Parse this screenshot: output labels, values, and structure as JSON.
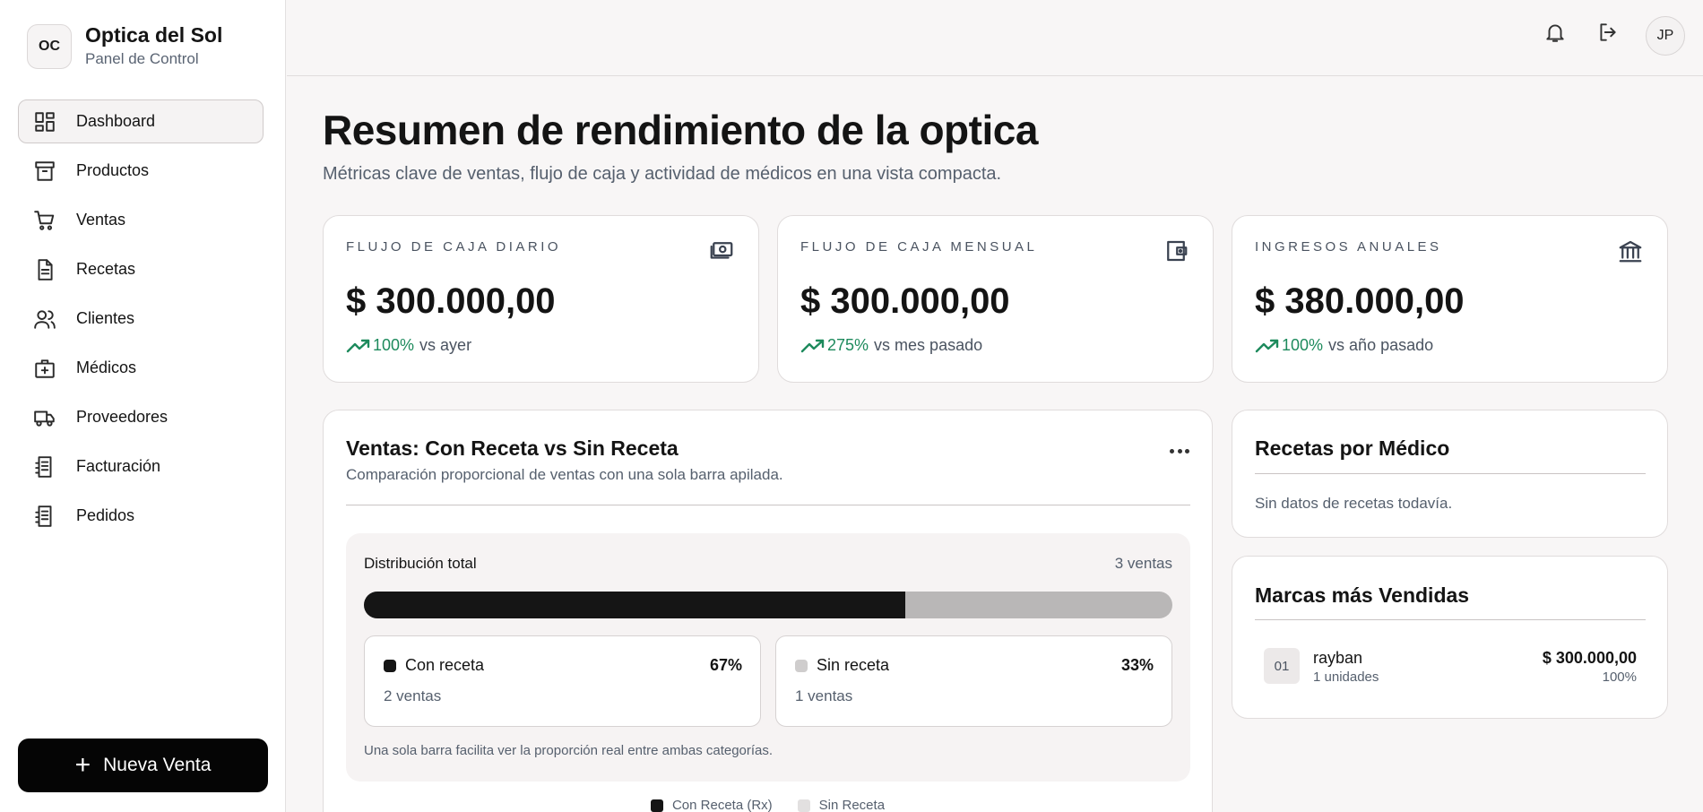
{
  "brand": {
    "logo": "OC",
    "name": "Optica del Sol",
    "subtitle": "Panel de Control"
  },
  "nav": [
    {
      "label": "Dashboard",
      "icon": "dashboard-icon",
      "active": true
    },
    {
      "label": "Productos",
      "icon": "archive-icon"
    },
    {
      "label": "Ventas",
      "icon": "cart-icon"
    },
    {
      "label": "Recetas",
      "icon": "document-icon"
    },
    {
      "label": "Clientes",
      "icon": "users-icon"
    },
    {
      "label": "Médicos",
      "icon": "medical-kit-icon"
    },
    {
      "label": "Proveedores",
      "icon": "truck-icon"
    },
    {
      "label": "Facturación",
      "icon": "receipt-icon"
    },
    {
      "label": "Pedidos",
      "icon": "receipt-icon"
    }
  ],
  "new_sale": {
    "label": "Nueva Venta"
  },
  "topbar": {
    "avatar": "JP"
  },
  "header": {
    "title": "Resumen de rendimiento de la optica",
    "subtitle": "Métricas clave de ventas, flujo de caja y actividad de médicos en una vista compacta."
  },
  "kpis": [
    {
      "label": "Flujo de caja diario",
      "value": "$ 300.000,00",
      "trend": "100%",
      "comparison": "vs ayer",
      "icon": "money-icon"
    },
    {
      "label": "Flujo de caja mensual",
      "value": "$ 300.000,00",
      "trend": "275%",
      "comparison": "vs mes pasado",
      "icon": "wallet-icon"
    },
    {
      "label": "Ingresos anuales",
      "value": "$ 380.000,00",
      "trend": "100%",
      "comparison": "vs año pasado",
      "icon": "bank-icon"
    }
  ],
  "sales": {
    "title": "Ventas: Con Receta vs Sin Receta",
    "subtitle": "Comparación proporcional de ventas con una sola barra apilada.",
    "distribution_label": "Distribución total",
    "total": "3 ventas",
    "segments": [
      {
        "name": "Con receta",
        "percent": "67%",
        "count": "2 ventas",
        "share": 0.67,
        "color": "#151515"
      },
      {
        "name": "Sin receta",
        "percent": "33%",
        "count": "1 ventas",
        "share": 0.33,
        "color": "#c8c6c6"
      }
    ],
    "note": "Una sola barra facilita ver la proporción real entre ambas categorías.",
    "legend": [
      {
        "name": "Con Receta (Rx)",
        "color": "#151515"
      },
      {
        "name": "Sin Receta",
        "color": "#e2e0e0"
      }
    ]
  },
  "prescriptions": {
    "title": "Recetas por Médico",
    "empty": "Sin datos de recetas todavía."
  },
  "top_brands": {
    "title": "Marcas más Vendidas",
    "items": [
      {
        "rank": "01",
        "name": "rayban",
        "units": "1 unidades",
        "amount": "$ 300.000,00",
        "share": "100%"
      }
    ]
  }
}
